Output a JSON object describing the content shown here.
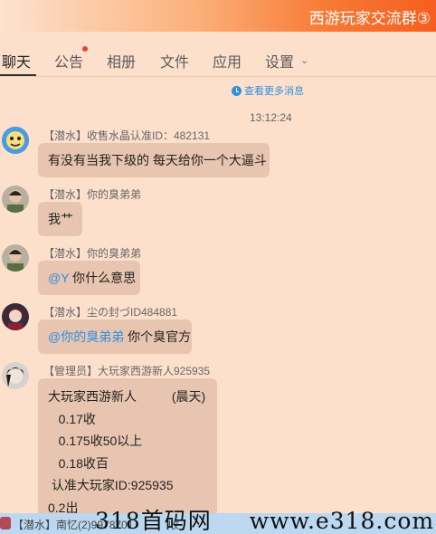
{
  "window": {
    "title": "西游玩家交流群③"
  },
  "tabs": [
    {
      "label": "聊天"
    },
    {
      "label": "公告"
    },
    {
      "label": "相册"
    },
    {
      "label": "文件"
    },
    {
      "label": "应用"
    },
    {
      "label": "设置"
    }
  ],
  "colors": {
    "accent": "#f55e1f",
    "link": "#2f8ee0",
    "bubble": "#e8c5b0",
    "background": "#fde0cc",
    "badge": "#e8432f"
  },
  "history": {
    "label": "查看更多消息",
    "icon": "clock-icon"
  },
  "timestamp": "13:12:24",
  "messages": [
    {
      "sender": "【潜水】收售水晶认准ID：482131",
      "text": "有没有当我下级的    每天给你一个大逼斗"
    },
    {
      "sender": "【潜水】你的臭弟弟",
      "text": "我艹"
    },
    {
      "sender": "【潜水】你的臭弟弟",
      "mention": "@Y",
      "text": " 你什么意思"
    },
    {
      "sender": "【潜水】尘の封づID484881",
      "mention": "@你的臭弟弟",
      "text": " 你个臭官方"
    },
    {
      "sender": "【管理员】大玩家西游新人925935",
      "lines": [
        "大玩家西游新人          (晨天)",
        "   0.17收",
        "   0.175收50以上",
        "   0.18收百",
        " 认准大玩家ID:925935",
        "0.2出"
      ]
    }
  ],
  "bottom": {
    "text": "【潜水】南忆(2)9978701",
    "value": "收"
  },
  "watermark": {
    "cn": "318首码网",
    "url": "www.e318.com"
  }
}
